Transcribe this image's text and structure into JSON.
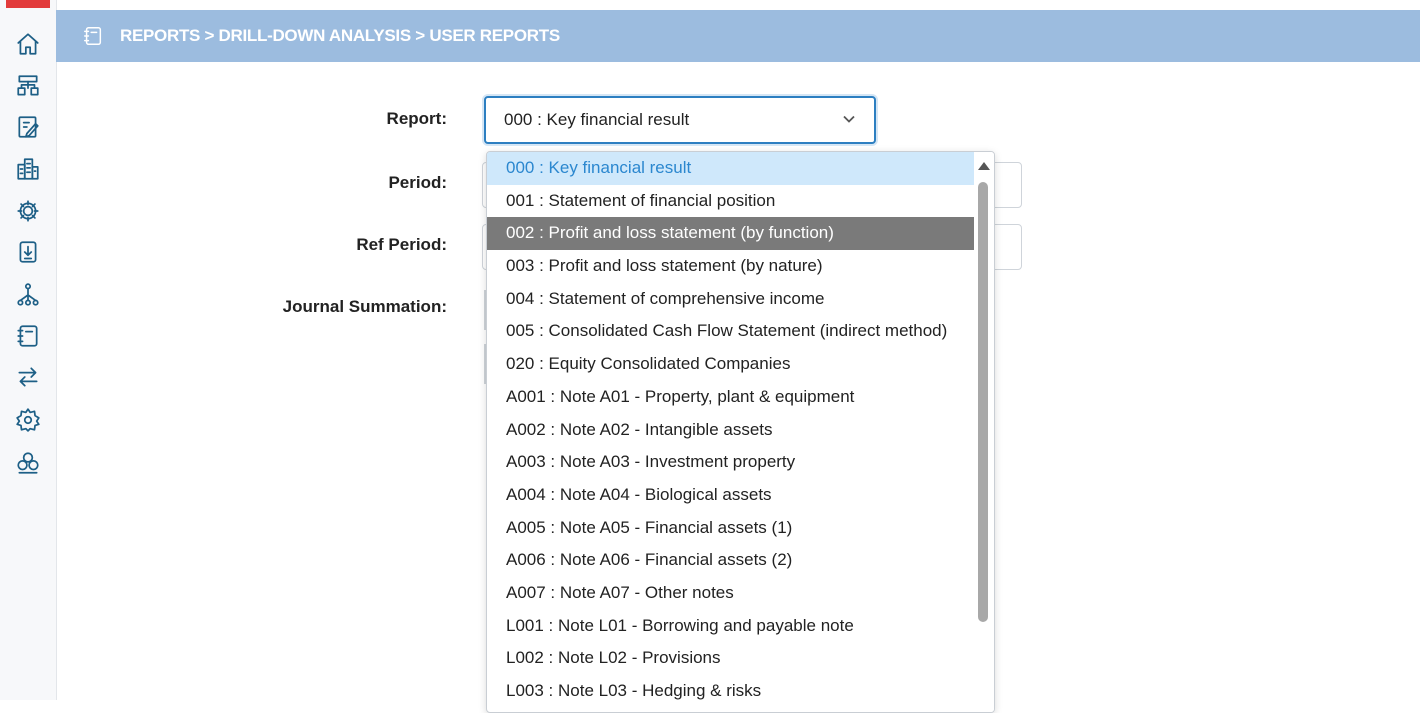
{
  "nav": {
    "icons": [
      "home-icon",
      "hierarchy-icon",
      "edit-report-icon",
      "buildings-icon",
      "gear-network-icon",
      "download-doc-icon",
      "org-chart-icon",
      "notebook-icon",
      "transfer-arrows-icon",
      "settings-gear-icon",
      "cloverleaf-icon"
    ]
  },
  "header": {
    "breadcrumb": "REPORTS > DRILL-DOWN ANALYSIS > USER REPORTS"
  },
  "form": {
    "report_label": "Report:",
    "period_label": "Period:",
    "ref_period_label": "Ref Period:",
    "journal_summation_label": "Journal Summation:",
    "report_value": "000 : Key financial result"
  },
  "dropdown": {
    "options": [
      "000 : Key financial result",
      "001 : Statement of financial position",
      "002 : Profit and loss statement (by function)",
      "003 : Profit and loss statement (by nature)",
      "004 : Statement of comprehensive income",
      "005 : Consolidated Cash Flow Statement (indirect method)",
      "020 : Equity Consolidated Companies",
      "A001 : Note A01 - Property, plant & equipment",
      "A002 : Note A02 - Intangible assets",
      "A003 : Note A03 - Investment property",
      "A004 : Note A04 - Biological assets",
      "A005 : Note A05 - Financial assets (1)",
      "A006 : Note A06 - Financial assets (2)",
      "A007 : Note A07 - Other notes",
      "L001 : Note L01 - Borrowing and payable note",
      "L002 : Note L02 - Provisions",
      "L003 : Note L03 - Hedging & risks"
    ]
  },
  "colors": {
    "header_bg": "#9cbcdf",
    "selected_bg": "#cfe8fb",
    "selected_text": "#2b87cf",
    "hover_bg": "#7a7a7a",
    "select_border": "#2d7fc1",
    "icon_color": "#1d5f86"
  }
}
